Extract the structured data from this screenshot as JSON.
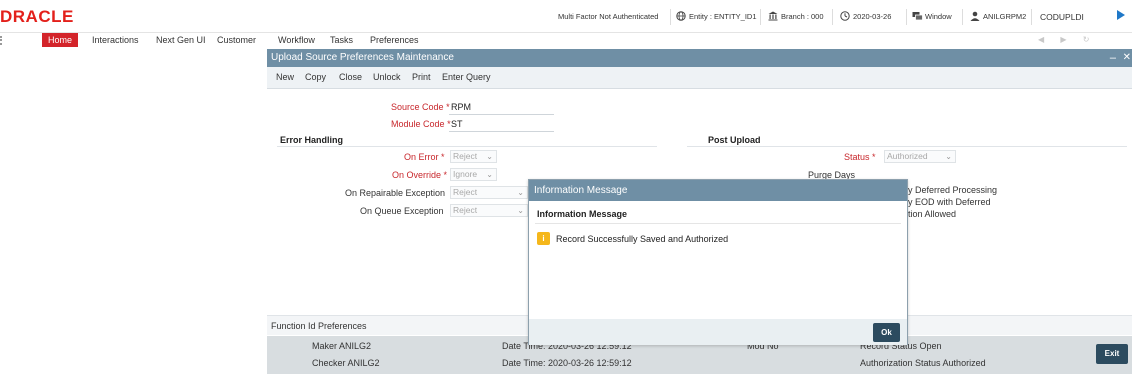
{
  "header": {
    "logo": "DRACLE",
    "mfa_status": "Multi Factor Not Authenticated",
    "entity": "Entity : ENTITY_ID1",
    "branch": "Branch : 000",
    "date": "2020-03-26",
    "window": "Window",
    "user": "ANILGRPM2",
    "app_user": "CODUPLDI"
  },
  "nav": {
    "items": [
      "Home",
      "Interactions",
      "Next Gen UI",
      "Customer",
      "Workflow",
      "Tasks",
      "Preferences"
    ],
    "arrows": "◀ ▶ ↻"
  },
  "window": {
    "title": "Upload Source Preferences Maintenance",
    "toolbar": [
      "New",
      "Copy",
      "Close",
      "Unlock",
      "Print",
      "Enter Query"
    ],
    "source_code_label": "Source Code",
    "source_code_value": "RPM",
    "module_code_label": "Module Code",
    "module_code_value": "ST",
    "error_handling": {
      "title": "Error Handling",
      "on_error_label": "On Error",
      "on_error_value": "Reject",
      "on_override_label": "On Override",
      "on_override_value": "Ignore",
      "on_repairable_label": "On Repairable Exception",
      "on_repairable_value": "Reject",
      "on_queue_label": "On Queue Exception",
      "on_queue_value": "Reject"
    },
    "post_upload": {
      "title": "Post Upload",
      "status_label": "Status",
      "status_value": "Authorized",
      "purge_days_label": "Purge Days",
      "deferred_processing": "y Deferred Processing",
      "eod_deferred": "y EOD with Deferred",
      "tion_allowed": "tion Allowed"
    },
    "function_id_prefs": "Function Id Preferences",
    "audit": {
      "maker": "Maker ANILG2",
      "checker": "Checker ANILG2",
      "maker_date": "Date Time: 2020-03-26 12:59:12",
      "checker_date": "Date Time: 2020-03-26 12:59:12",
      "mod_no": "Mod No",
      "record_status": "Record Status Open",
      "auth_status": "Authorization Status Authorized"
    },
    "exit_label": "Exit"
  },
  "modal": {
    "title": "Information Message",
    "subtitle": "Information Message",
    "message": "Record Successfully Saved and Authorized",
    "ok_label": "Ok"
  }
}
